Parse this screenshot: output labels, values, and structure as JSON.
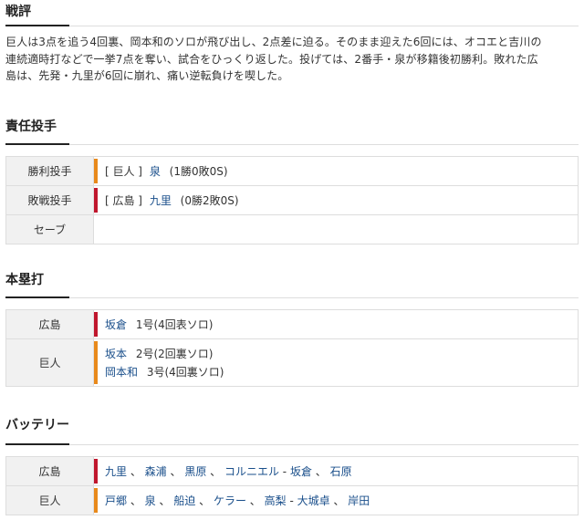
{
  "review": {
    "title": "戦評",
    "lines": [
      "巨人は3点を追う4回裏、岡本和のソロが飛び出し、2点差に迫る。そのまま迎えた6回には、オコエと吉川の",
      "連続適時打などで一挙7点を奪い、試合をひっくり返した。投げては、2番手・泉が移籍後初勝利。敗れた広",
      "島は、先発・九里が6回に崩れ、痛い逆転負けを喫した。"
    ]
  },
  "pitchers": {
    "title": "責任投手",
    "rows": [
      {
        "label": "勝利投手",
        "team": "[ 巨人 ]",
        "name": "泉",
        "stat": "(1勝0敗0S)",
        "bar": "orange"
      },
      {
        "label": "敗戦投手",
        "team": "[ 広島 ]",
        "name": "九里",
        "stat": "(0勝2敗0S)",
        "bar": "red"
      },
      {
        "label": "セーブ",
        "team": "",
        "name": "",
        "stat": "",
        "bar": ""
      }
    ]
  },
  "homeruns": {
    "title": "本塁打",
    "rows": [
      {
        "label": "広島",
        "bar": "red",
        "entries": [
          {
            "name": "坂倉",
            "detail": "1号(4回表ソロ)"
          }
        ]
      },
      {
        "label": "巨人",
        "bar": "orange",
        "entries": [
          {
            "name": "坂本",
            "detail": "2号(2回裏ソロ)"
          },
          {
            "name": "岡本和",
            "detail": "3号(4回裏ソロ)"
          }
        ]
      }
    ]
  },
  "battery": {
    "title": "バッテリー",
    "rows": [
      {
        "label": "広島",
        "bar": "red",
        "pitchers": [
          "九里",
          "森浦",
          "黒原",
          "コルニエル"
        ],
        "catchers": [
          "坂倉",
          "石原"
        ]
      },
      {
        "label": "巨人",
        "bar": "orange",
        "pitchers": [
          "戸郷",
          "泉",
          "船迫",
          "ケラー",
          "高梨"
        ],
        "catchers": [
          "大城卓",
          "岸田"
        ]
      }
    ]
  },
  "colors": {
    "red": "#c0162d",
    "orange": "#e8891b",
    "link": "#1a4f8b"
  }
}
